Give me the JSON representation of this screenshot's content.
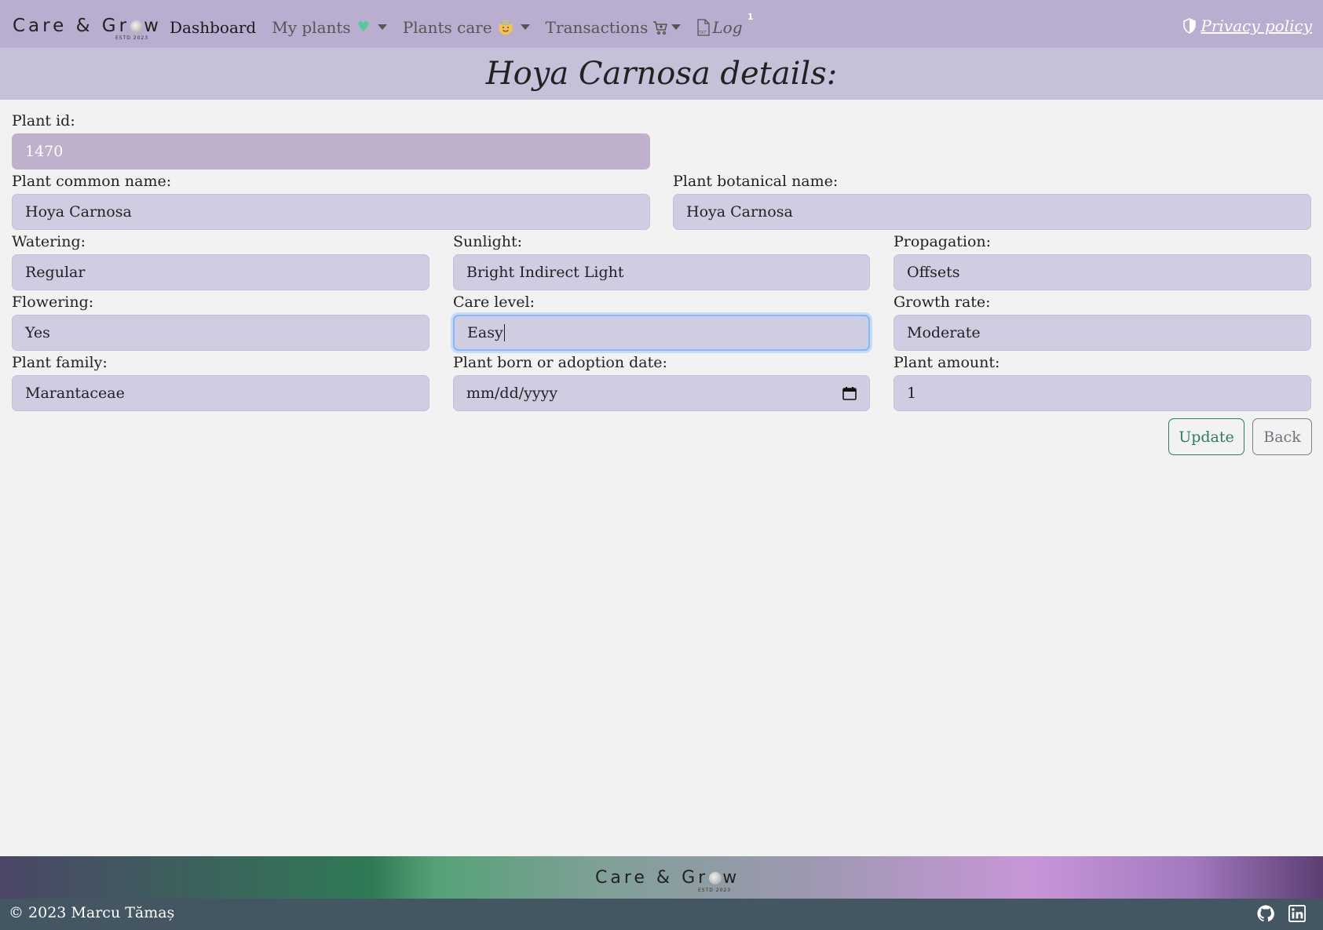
{
  "navbar": {
    "brand": {
      "part1": "Care & Gr",
      "part2": "w",
      "estd": "ESTD 2023"
    },
    "items": [
      {
        "label": "Dashboard"
      },
      {
        "label": "My plants"
      },
      {
        "label": "Plants care"
      },
      {
        "label": "Transactions"
      },
      {
        "label": "Log",
        "badge": "1"
      }
    ],
    "privacy_label": "Privacy policy"
  },
  "page": {
    "title": "Hoya Carnosa details:"
  },
  "form": {
    "plant_id": {
      "label": "Plant id:",
      "value": "1470"
    },
    "common_name": {
      "label": "Plant common name:",
      "value": "Hoya Carnosa"
    },
    "botanical_name": {
      "label": "Plant botanical name:",
      "value": "Hoya Carnosa"
    },
    "watering": {
      "label": "Watering:",
      "value": "Regular"
    },
    "sunlight": {
      "label": "Sunlight:",
      "value": "Bright Indirect Light"
    },
    "propagation": {
      "label": "Propagation:",
      "value": "Offsets"
    },
    "flowering": {
      "label": "Flowering:",
      "value": "Yes"
    },
    "care_level": {
      "label": "Care level:",
      "value": "Easy"
    },
    "growth_rate": {
      "label": "Growth rate:",
      "value": "Moderate"
    },
    "family": {
      "label": "Plant family:",
      "value": "Marantaceae"
    },
    "adoption_date": {
      "label": "Plant born or adoption date:",
      "placeholder": "mm/dd/yyyy"
    },
    "amount": {
      "label": "Plant amount:",
      "value": "1"
    },
    "update_label": "Update",
    "back_label": "Back"
  },
  "footer": {
    "brand": {
      "part1": "Care & Gr",
      "part2": "w",
      "estd": "ESTD 2023"
    },
    "copyright": "© 2023 Marcu Tămaș"
  },
  "colors": {
    "navbar_bg": "#b9aecf",
    "header_bg": "#c6c0d8",
    "input_bg": "#cfcde2",
    "readonly_bg": "#bfb0cc",
    "update_accent": "#2e7d5a",
    "footer_bg": "#455663"
  },
  "icons": [
    "green-heart-icon",
    "smiling-face-icon",
    "cart-icon",
    "txt-file-icon",
    "shield-icon",
    "calendar-icon",
    "github-icon",
    "linkedin-icon"
  ]
}
